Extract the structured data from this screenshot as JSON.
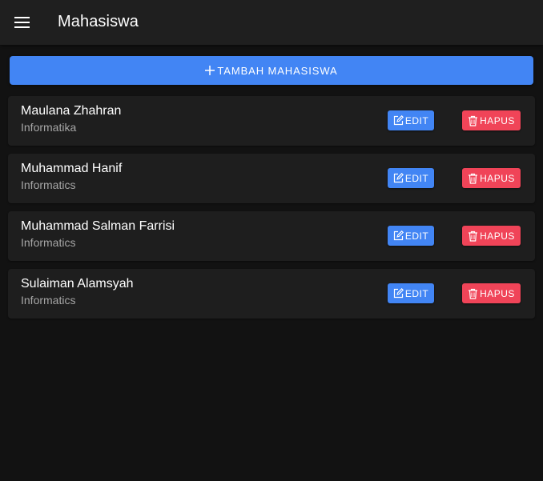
{
  "header": {
    "menu_icon": "menu-icon",
    "title": "Mahasiswa"
  },
  "actions": {
    "add_icon": "plus-icon",
    "add_label": "TAMBAH MAHASISWA"
  },
  "students": [
    {
      "name": "Maulana Zhahran",
      "major": "Informatika",
      "edit_label": "EDIT",
      "delete_label": "HAPUS"
    },
    {
      "name": "Muhammad Hanif",
      "major": "Informatics",
      "edit_label": "EDIT",
      "delete_label": "HAPUS"
    },
    {
      "name": "Muhammad Salman Farrisi",
      "major": "Informatics",
      "edit_label": "EDIT",
      "delete_label": "HAPUS"
    },
    {
      "name": "Sulaiman Alamsyah",
      "major": "Informatics",
      "edit_label": "EDIT",
      "delete_label": "HAPUS"
    }
  ],
  "icons": {
    "edit": "edit-icon",
    "delete": "trash-icon"
  },
  "colors": {
    "background": "#121212",
    "toolbar": "#1f1f1f",
    "card": "#1e1e1e",
    "primary": "#4285f4",
    "danger": "#f04458",
    "secondary_text": "#a6a6a6"
  }
}
